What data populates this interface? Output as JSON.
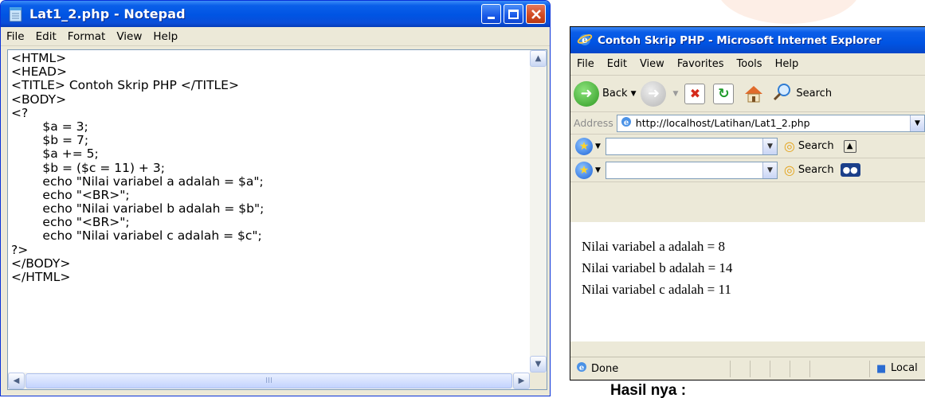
{
  "notepad": {
    "title": "Lat1_2.php - Notepad",
    "menu": [
      "File",
      "Edit",
      "Format",
      "View",
      "Help"
    ],
    "code_lines": [
      "<HTML>",
      "<HEAD>",
      "<TITLE> Contoh Skrip PHP </TITLE>",
      "<BODY>",
      "<?",
      "\t$a = 3;",
      "\t$b = 7;",
      "\t$a += 5;",
      "\t$b = ($c = 11) + 3;",
      "\techo \"Nilai variabel a adalah = $a\";",
      "\techo \"<BR>\";",
      "\techo \"Nilai variabel b adalah = $b\";",
      "\techo \"<BR>\";",
      "\techo \"Nilai variabel c adalah = $c\";",
      "?>",
      "</BODY>",
      "</HTML>"
    ],
    "hscroll_grip": "III"
  },
  "ie": {
    "title": "Contoh Skrip PHP - Microsoft Internet Explorer",
    "menu": [
      "File",
      "Edit",
      "View",
      "Favorites",
      "Tools",
      "Help"
    ],
    "toolbar": {
      "back_label": "Back",
      "search_label": "Search"
    },
    "address_label": "Address",
    "address_value": "http://localhost/Latihan/Lat1_2.php",
    "bar1_search": "Search",
    "bar2_search": "Search",
    "output_lines": [
      "Nilai variabel a adalah = 8",
      "Nilai variabel b adalah = 14",
      "Nilai variabel c adalah = 11"
    ],
    "status_text": "Done",
    "status_zone": "Local"
  },
  "caption": "Hasil nya :",
  "colors": {
    "xp_blue": "#0054e3",
    "close_red": "#d24b23"
  }
}
